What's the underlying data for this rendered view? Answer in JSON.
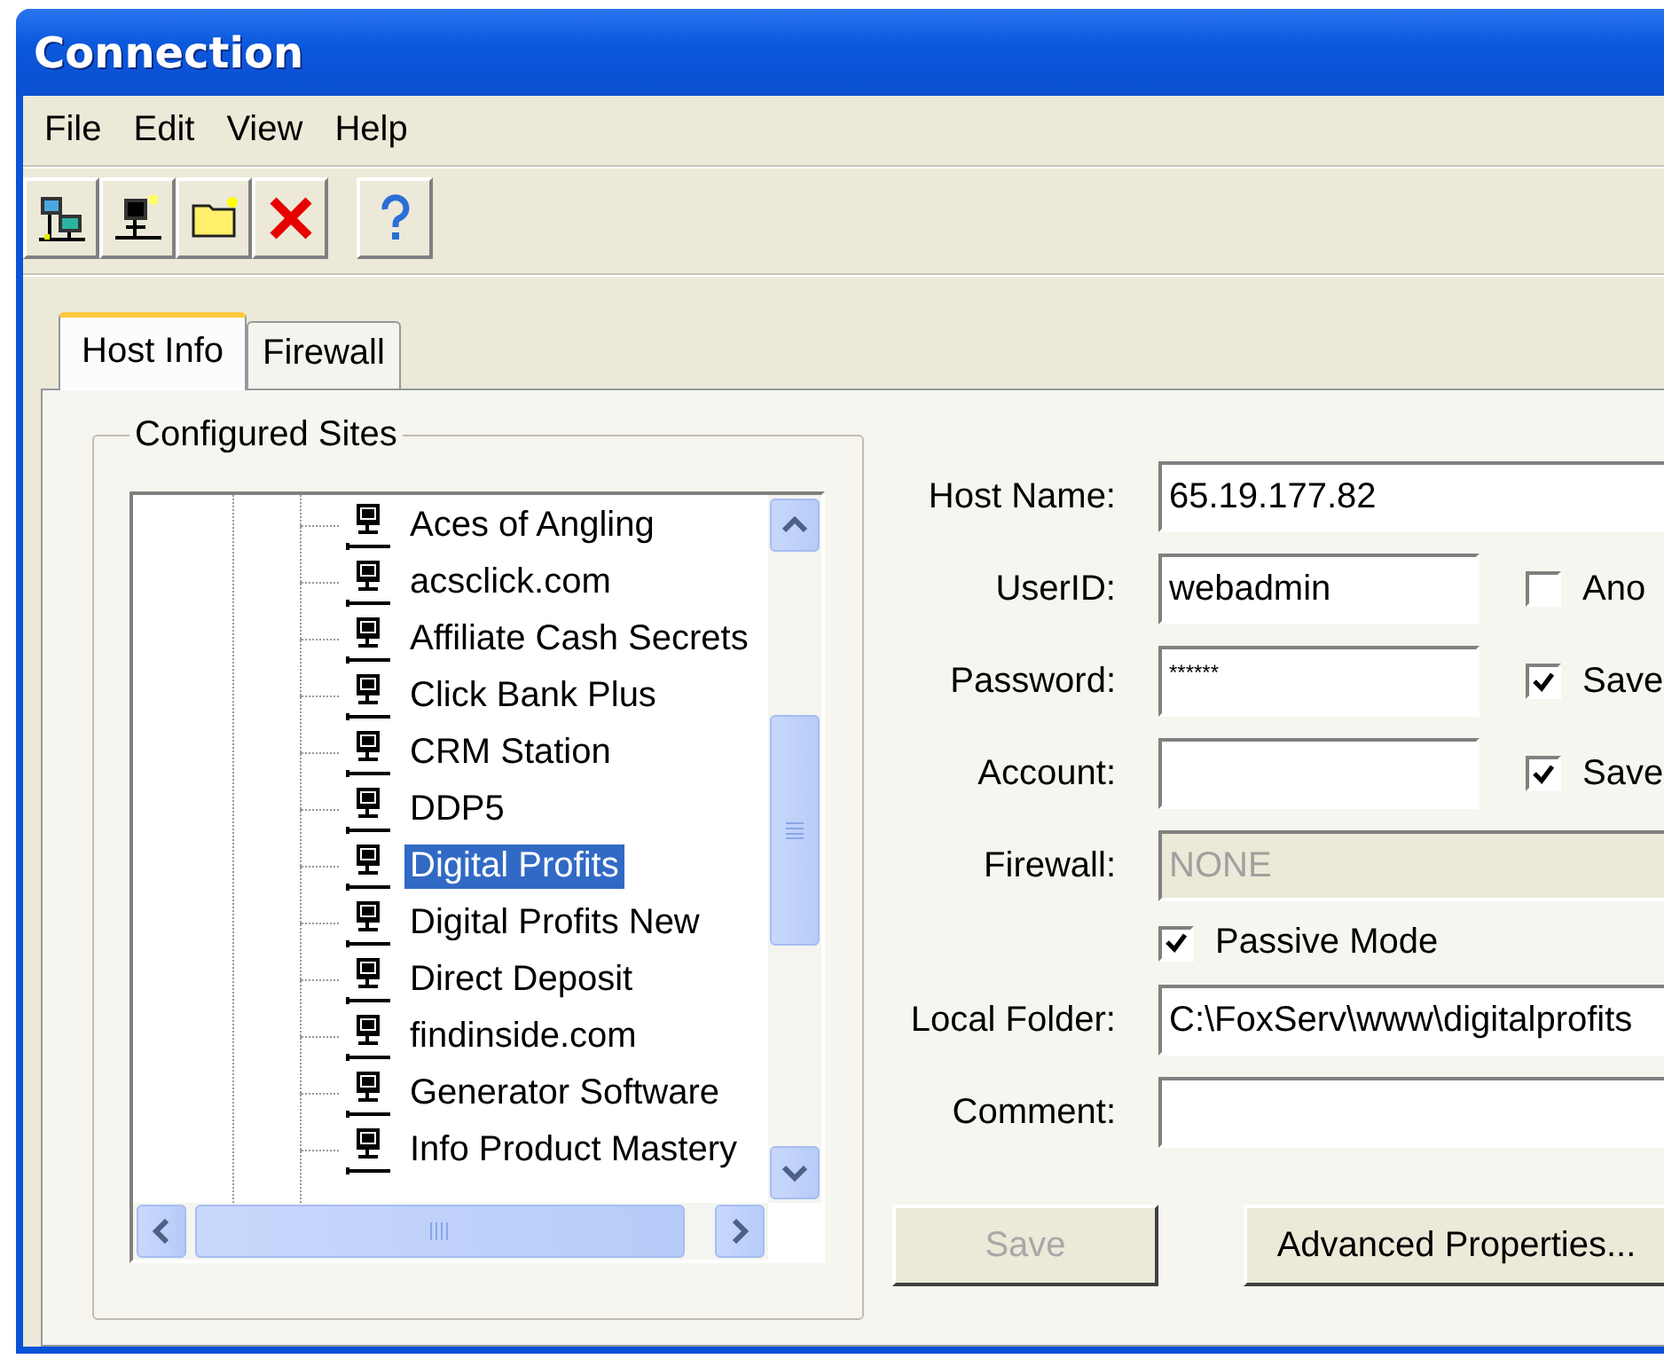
{
  "window": {
    "title": "Connection"
  },
  "menu": [
    "File",
    "Edit",
    "View",
    "Help"
  ],
  "toolbar": [
    {
      "kind": "computers"
    },
    {
      "kind": "computer"
    },
    {
      "kind": "folder"
    },
    {
      "kind": "delete"
    },
    {
      "kind": "help"
    }
  ],
  "tabs": [
    {
      "label": "Host Info",
      "selected": true
    },
    {
      "label": "Firewall",
      "selected": false
    }
  ],
  "sites": {
    "title": "Configured Sites",
    "items": [
      {
        "label": "Aces of Angling",
        "selected": false
      },
      {
        "label": "acsclick.com",
        "selected": false
      },
      {
        "label": "Affiliate Cash Secrets",
        "selected": false
      },
      {
        "label": "Click Bank Plus",
        "selected": false
      },
      {
        "label": "CRM Station",
        "selected": false
      },
      {
        "label": "DDP5",
        "selected": false
      },
      {
        "label": "Digital Profits",
        "selected": true
      },
      {
        "label": "Digital Profits New",
        "selected": false
      },
      {
        "label": "Direct Deposit",
        "selected": false
      },
      {
        "label": "findinside.com",
        "selected": false
      },
      {
        "label": "Generator Software",
        "selected": false
      },
      {
        "label": "Info Product Mastery",
        "selected": false
      }
    ]
  },
  "form": {
    "rows": [
      {
        "kind": "wide",
        "label": "Host Name:",
        "value": "65.19.177.82"
      },
      {
        "kind": "short",
        "label": "UserID:",
        "value": "webadmin",
        "check": {
          "label": "Ano",
          "checked": false
        }
      },
      {
        "kind": "password",
        "label": "Password:",
        "value": "******",
        "check": {
          "label": "Save",
          "checked": true
        }
      },
      {
        "kind": "short",
        "label": "Account:",
        "check": {
          "label": "Save",
          "checked": true
        }
      },
      {
        "kind": "combo",
        "label": "Firewall:",
        "value": "NONE",
        "disabled": true
      },
      {
        "kind": "checkbox",
        "label": "Passive Mode",
        "checked": true
      },
      {
        "kind": "wide",
        "label": "Local Folder:",
        "value": "C:\\FoxServ\\www\\digitalprofits"
      },
      {
        "kind": "wide",
        "label": "Comment:"
      }
    ],
    "buttons": [
      {
        "label": "Save",
        "disabled": true
      },
      {
        "label": "Advanced Properties...",
        "disabled": false
      }
    ]
  }
}
